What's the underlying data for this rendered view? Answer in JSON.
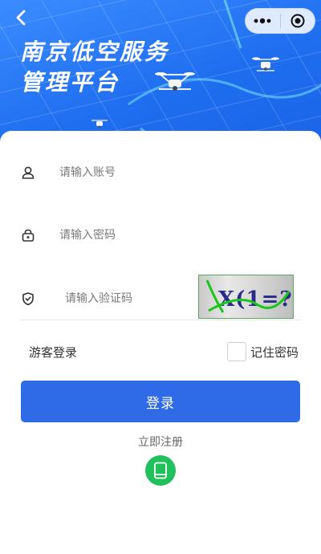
{
  "header": {
    "title_line1": "南京低空服务",
    "title_line2": "管理平台"
  },
  "form": {
    "account_placeholder": "请输入账号",
    "password_placeholder": "请输入密码",
    "captcha_placeholder": "请输入验证码",
    "captcha_text": "X(1=?"
  },
  "options": {
    "guest_login": "游客登录",
    "remember_password": "记住密码",
    "remember_checked": false
  },
  "actions": {
    "login_label": "登录",
    "register_label": "立即注册"
  },
  "colors": {
    "hero_blue": "#1f6ef0",
    "primary_button": "#2f6be6",
    "phone_green": "#20c05c"
  },
  "icons": [
    "back-icon",
    "more-icon",
    "close-icon",
    "user-icon",
    "lock-icon",
    "shield-icon",
    "phone-icon",
    "drone-icon"
  ]
}
